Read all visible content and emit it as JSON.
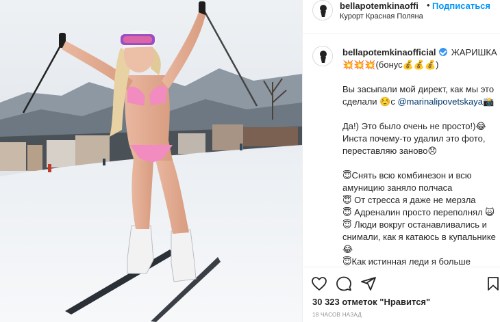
{
  "post": {
    "username": "bellapotemkinaoffi",
    "separator": "•",
    "follow_label": "Подписаться",
    "location": "Курорт Красная Поляна"
  },
  "caption": {
    "username": "bellapotemkinaofficial",
    "lines": [
      "ЖАРИШКА 💥💥💥(бонус💰💰💰)",
      "",
      "Вы засыпали мой директ, как мы это сделали ☺️с @marinalipovetskaya📸",
      "",
      "Да!) Это было очень не просто!)😂 Инста почему-то удалил это фото, переставляю заново😞",
      "",
      "😇Снять всю комбинезон и всю амуницию заняло полчаса",
      "😇 От стресса я даже не мерзла",
      "😇 Адреналин просто переполнял 🙀",
      "😇 Люди вокруг останавливались и снимали, как я катаюсь в купальнике 😂",
      "😇Как истинная леди я больше переживала, хорошо ли сидит"
    ]
  },
  "engagement": {
    "likes_text": "30 323 отметок \"Нравится\"",
    "time_text": "18 часов назад"
  },
  "icons": {
    "like": "heart-icon",
    "comment": "comment-icon",
    "share": "share-icon",
    "save": "bookmark-icon",
    "verified": "verified-badge-icon"
  },
  "colors": {
    "accent": "#0095f6",
    "mention": "#00376b",
    "muted": "#8e8e8e",
    "text": "#262626"
  }
}
